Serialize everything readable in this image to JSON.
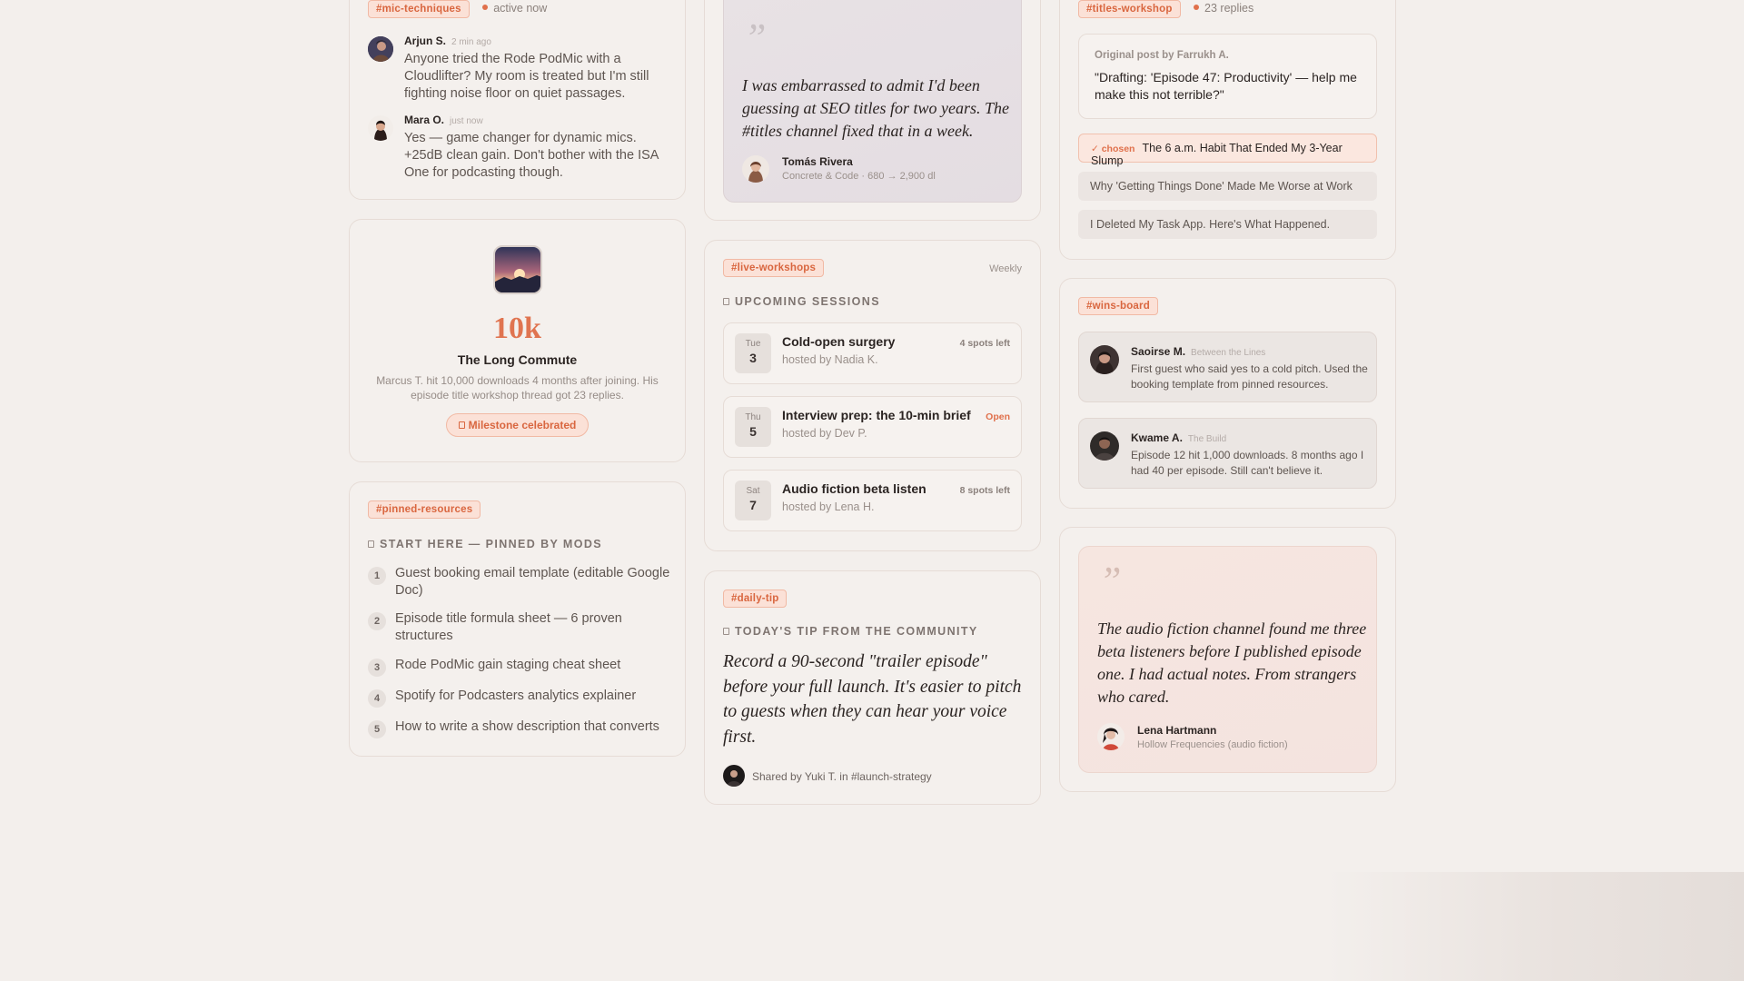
{
  "col1": {
    "mic": {
      "tag": "#mic-techniques",
      "status": "active now",
      "messages": [
        {
          "name": "Arjun S.",
          "time": "2 min ago",
          "text": "Anyone tried the Rode PodMic with a Cloudlifter? My room is treated but I'm still fighting noise floor on quiet passages."
        },
        {
          "name": "Mara O.",
          "time": "just now",
          "text": "Yes — game changer for dynamic mics. +25dB clean gain. Don't bother with the ISA One for podcasting though."
        }
      ]
    },
    "milestone": {
      "number": "10k",
      "show": "The Long Commute",
      "desc": "Marcus T. hit 10,000 downloads 4 months after joining. His episode title workshop thread got 23 replies.",
      "badge": "Milestone celebrated"
    },
    "pinned": {
      "tag": "#pinned-resources",
      "title": "Start here — pinned by mods",
      "items": [
        {
          "num": "1",
          "text": "Guest booking email template (editable Google Doc)"
        },
        {
          "num": "2",
          "text": "Episode title formula sheet — 6 proven structures"
        },
        {
          "num": "3",
          "text": "Rode PodMic gain staging cheat sheet"
        },
        {
          "num": "4",
          "text": "Spotify for Podcasters analytics explainer"
        },
        {
          "num": "5",
          "text": "How to write a show description that converts"
        }
      ]
    }
  },
  "col2": {
    "quote": {
      "mark": "”",
      "text": "I was embarrassed to admit I'd been guessing at SEO titles for two years. The #titles channel fixed that in a week.",
      "author": "Tomás Rivera",
      "meta": "Concrete & Code · 680 → 2,900 dl"
    },
    "workshops": {
      "tag": "#live-workshops",
      "frequency": "Weekly",
      "title": "Upcoming sessions",
      "sessions": [
        {
          "dow": "Tue",
          "day": "3",
          "title": "Cold-open surgery",
          "host": "hosted by Nadia K.",
          "spots": "4 spots left"
        },
        {
          "dow": "Thu",
          "day": "5",
          "title": "Interview prep: the 10-min brief",
          "host": "hosted by Dev P.",
          "spots": "Open"
        },
        {
          "dow": "Sat",
          "day": "7",
          "title": "Audio fiction beta listen",
          "host": "hosted by Lena H.",
          "spots": "8 spots left"
        }
      ]
    },
    "tip": {
      "tag": "#daily-tip",
      "title": "Today's tip from the community",
      "text": "Record a 90-second \"trailer episode\" before your full launch. It's easier to pitch to guests when they can hear your voice first.",
      "shared": "Shared by Yuki T. in #launch-strategy"
    }
  },
  "col3": {
    "titles": {
      "tag": "#titles-workshop",
      "replies": "23 replies",
      "original_label": "Original post by Farrukh A.",
      "original_text": "\"Drafting: 'Episode 47: Productivity' — help me make this not terrible?\"",
      "chosen_label": "✓ chosen",
      "options": [
        "The 6 a.m. Habit That Ended My 3-Year Slump",
        "Why 'Getting Things Done' Made Me Worse at Work",
        "I Deleted My Task App. Here's What Happened."
      ]
    },
    "wins": {
      "tag": "#wins-board",
      "items": [
        {
          "name": "Saoirse M.",
          "show": "Between the Lines",
          "text": "First guest who said yes to a cold pitch. Used the booking template from pinned resources."
        },
        {
          "name": "Kwame A.",
          "show": "The Build",
          "text": "Episode 12 hit 1,000 downloads. 8 months ago I had 40 per episode. Still can't believe it."
        }
      ]
    },
    "quote": {
      "mark": "”",
      "text": "The audio fiction channel found me three beta listeners before I published episode one. I had actual notes. From strangers who cared.",
      "author": "Lena Hartmann",
      "meta": "Hollow Frequencies (audio fiction)"
    }
  },
  "colors": {
    "accent": "#e0704b",
    "tag_bg": "#fbe1d7",
    "page_bg": "#f3efec",
    "card_border": "#e6dcd6"
  }
}
